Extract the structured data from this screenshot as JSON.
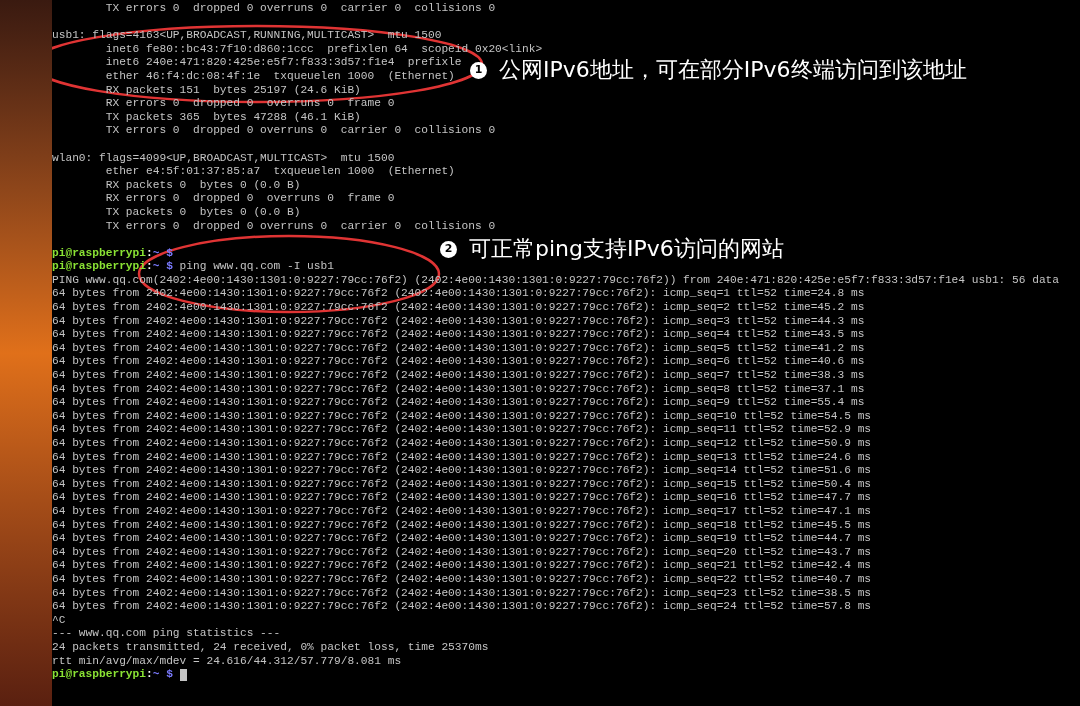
{
  "terminal": {
    "lines": [
      {
        "kind": "output",
        "text": "        TX errors 0  dropped 0 overruns 0  carrier 0  collisions 0"
      },
      {
        "kind": "blank"
      },
      {
        "kind": "output",
        "text": "usb1: flags=4163<UP,BROADCAST,RUNNING,MULTICAST>  mtu 1500"
      },
      {
        "kind": "output",
        "text": "        inet6 fe80::bc43:7f10:d860:1ccc  prefixlen 64  scopeid 0x20<link>"
      },
      {
        "kind": "output",
        "text": "        inet6 240e:471:820:425e:e5f7:f833:3d57:f1e4  prefixle"
      },
      {
        "kind": "output",
        "text": "        ether 46:f4:dc:08:4f:1e  txqueuelen 1000  (Ethernet)"
      },
      {
        "kind": "output",
        "text": "        RX packets 151  bytes 25197 (24.6 KiB)"
      },
      {
        "kind": "output",
        "text": "        RX errors 0  dropped 0  overruns 0  frame 0"
      },
      {
        "kind": "output",
        "text": "        TX packets 365  bytes 47288 (46.1 KiB)"
      },
      {
        "kind": "output",
        "text": "        TX errors 0  dropped 0 overruns 0  carrier 0  collisions 0"
      },
      {
        "kind": "blank"
      },
      {
        "kind": "output",
        "text": "wlan0: flags=4099<UP,BROADCAST,MULTICAST>  mtu 1500"
      },
      {
        "kind": "output",
        "text": "        ether e4:5f:01:37:85:a7  txqueuelen 1000  (Ethernet)"
      },
      {
        "kind": "output",
        "text": "        RX packets 0  bytes 0 (0.0 B)"
      },
      {
        "kind": "output",
        "text": "        RX errors 0  dropped 0  overruns 0  frame 0"
      },
      {
        "kind": "output",
        "text": "        TX packets 0  bytes 0 (0.0 B)"
      },
      {
        "kind": "output",
        "text": "        TX errors 0  dropped 0 overruns 0  carrier 0  collisions 0"
      },
      {
        "kind": "blank"
      },
      {
        "kind": "prompt",
        "user": "pi@raspberrypi",
        "separator": ":",
        "path": "~ $"
      },
      {
        "kind": "prompt",
        "user": "pi@raspberrypi",
        "separator": ":",
        "path": "~ $",
        "command": "ping www.qq.com -I usb1"
      },
      {
        "kind": "output",
        "text": "PING www.qq.com(2402:4e00:1430:1301:0:9227:79cc:76f2) (2402:4e00:1430:1301:0:9227:79cc:76f2)) from 240e:471:820:425e:e5f7:f833:3d57:f1e4 usb1: 56 data"
      },
      {
        "kind": "output",
        "text": "64 bytes from 2402:4e00:1430:1301:0:9227:79cc:76f2 (2402:4e00:1430:1301:0:9227:79cc:76f2): icmp_seq=1 ttl=52 time=24.8 ms"
      },
      {
        "kind": "output",
        "text": "64 bytes from 2402:4e00:1430:1301:0:9227:79cc:76f2 (2402:4e00:1430:1301:0:9227:79cc:76f2): icmp_seq=2 ttl=52 time=45.2 ms"
      },
      {
        "kind": "output",
        "text": "64 bytes from 2402:4e00:1430:1301:0:9227:79cc:76f2 (2402:4e00:1430:1301:0:9227:79cc:76f2): icmp_seq=3 ttl=52 time=44.3 ms"
      },
      {
        "kind": "output",
        "text": "64 bytes from 2402:4e00:1430:1301:0:9227:79cc:76f2 (2402:4e00:1430:1301:0:9227:79cc:76f2): icmp_seq=4 ttl=52 time=43.5 ms"
      },
      {
        "kind": "output",
        "text": "64 bytes from 2402:4e00:1430:1301:0:9227:79cc:76f2 (2402:4e00:1430:1301:0:9227:79cc:76f2): icmp_seq=5 ttl=52 time=41.2 ms"
      },
      {
        "kind": "output",
        "text": "64 bytes from 2402:4e00:1430:1301:0:9227:79cc:76f2 (2402:4e00:1430:1301:0:9227:79cc:76f2): icmp_seq=6 ttl=52 time=40.6 ms"
      },
      {
        "kind": "output",
        "text": "64 bytes from 2402:4e00:1430:1301:0:9227:79cc:76f2 (2402:4e00:1430:1301:0:9227:79cc:76f2): icmp_seq=7 ttl=52 time=38.3 ms"
      },
      {
        "kind": "output",
        "text": "64 bytes from 2402:4e00:1430:1301:0:9227:79cc:76f2 (2402:4e00:1430:1301:0:9227:79cc:76f2): icmp_seq=8 ttl=52 time=37.1 ms"
      },
      {
        "kind": "output",
        "text": "64 bytes from 2402:4e00:1430:1301:0:9227:79cc:76f2 (2402:4e00:1430:1301:0:9227:79cc:76f2): icmp_seq=9 ttl=52 time=55.4 ms"
      },
      {
        "kind": "output",
        "text": "64 bytes from 2402:4e00:1430:1301:0:9227:79cc:76f2 (2402:4e00:1430:1301:0:9227:79cc:76f2): icmp_seq=10 ttl=52 time=54.5 ms"
      },
      {
        "kind": "output",
        "text": "64 bytes from 2402:4e00:1430:1301:0:9227:79cc:76f2 (2402:4e00:1430:1301:0:9227:79cc:76f2): icmp_seq=11 ttl=52 time=52.9 ms"
      },
      {
        "kind": "output",
        "text": "64 bytes from 2402:4e00:1430:1301:0:9227:79cc:76f2 (2402:4e00:1430:1301:0:9227:79cc:76f2): icmp_seq=12 ttl=52 time=50.9 ms"
      },
      {
        "kind": "output",
        "text": "64 bytes from 2402:4e00:1430:1301:0:9227:79cc:76f2 (2402:4e00:1430:1301:0:9227:79cc:76f2): icmp_seq=13 ttl=52 time=24.6 ms"
      },
      {
        "kind": "output",
        "text": "64 bytes from 2402:4e00:1430:1301:0:9227:79cc:76f2 (2402:4e00:1430:1301:0:9227:79cc:76f2): icmp_seq=14 ttl=52 time=51.6 ms"
      },
      {
        "kind": "output",
        "text": "64 bytes from 2402:4e00:1430:1301:0:9227:79cc:76f2 (2402:4e00:1430:1301:0:9227:79cc:76f2): icmp_seq=15 ttl=52 time=50.4 ms"
      },
      {
        "kind": "output",
        "text": "64 bytes from 2402:4e00:1430:1301:0:9227:79cc:76f2 (2402:4e00:1430:1301:0:9227:79cc:76f2): icmp_seq=16 ttl=52 time=47.7 ms"
      },
      {
        "kind": "output",
        "text": "64 bytes from 2402:4e00:1430:1301:0:9227:79cc:76f2 (2402:4e00:1430:1301:0:9227:79cc:76f2): icmp_seq=17 ttl=52 time=47.1 ms"
      },
      {
        "kind": "output",
        "text": "64 bytes from 2402:4e00:1430:1301:0:9227:79cc:76f2 (2402:4e00:1430:1301:0:9227:79cc:76f2): icmp_seq=18 ttl=52 time=45.5 ms"
      },
      {
        "kind": "output",
        "text": "64 bytes from 2402:4e00:1430:1301:0:9227:79cc:76f2 (2402:4e00:1430:1301:0:9227:79cc:76f2): icmp_seq=19 ttl=52 time=44.7 ms"
      },
      {
        "kind": "output",
        "text": "64 bytes from 2402:4e00:1430:1301:0:9227:79cc:76f2 (2402:4e00:1430:1301:0:9227:79cc:76f2): icmp_seq=20 ttl=52 time=43.7 ms"
      },
      {
        "kind": "output",
        "text": "64 bytes from 2402:4e00:1430:1301:0:9227:79cc:76f2 (2402:4e00:1430:1301:0:9227:79cc:76f2): icmp_seq=21 ttl=52 time=42.4 ms"
      },
      {
        "kind": "output",
        "text": "64 bytes from 2402:4e00:1430:1301:0:9227:79cc:76f2 (2402:4e00:1430:1301:0:9227:79cc:76f2): icmp_seq=22 ttl=52 time=40.7 ms"
      },
      {
        "kind": "output",
        "text": "64 bytes from 2402:4e00:1430:1301:0:9227:79cc:76f2 (2402:4e00:1430:1301:0:9227:79cc:76f2): icmp_seq=23 ttl=52 time=38.5 ms"
      },
      {
        "kind": "output",
        "text": "64 bytes from 2402:4e00:1430:1301:0:9227:79cc:76f2 (2402:4e00:1430:1301:0:9227:79cc:76f2): icmp_seq=24 ttl=52 time=57.8 ms"
      },
      {
        "kind": "output",
        "text": "^C"
      },
      {
        "kind": "output",
        "text": "--- www.qq.com ping statistics ---"
      },
      {
        "kind": "output",
        "text": "24 packets transmitted, 24 received, 0% packet loss, time 25370ms"
      },
      {
        "kind": "output",
        "text": "rtt min/avg/max/mdev = 24.616/44.312/57.779/8.081 ms"
      },
      {
        "kind": "prompt",
        "user": "pi@raspberrypi",
        "separator": ":",
        "path": "~ $",
        "cursor": true
      }
    ]
  },
  "annotations": [
    {
      "number": "1",
      "text": "公网IPv6地址，可在部分IPv6终端访问到该地址"
    },
    {
      "number": "2",
      "text": "可正常ping支持IPv6访问的网站"
    }
  ]
}
